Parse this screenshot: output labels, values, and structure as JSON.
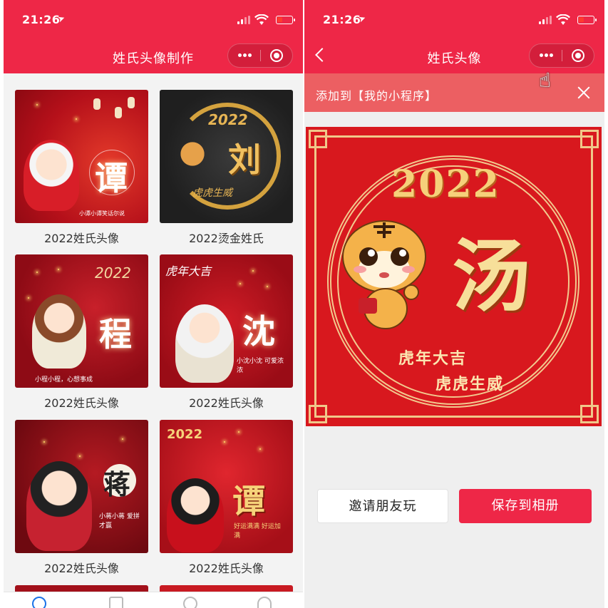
{
  "status": {
    "time": "21:26"
  },
  "left": {
    "title": "姓氏头像制作",
    "cards": [
      {
        "caption": "2022姓氏头像",
        "surname": "谭",
        "tagline": "小谭小谭笑话尔说"
      },
      {
        "caption": "2022烫金姓氏",
        "surname": "刘",
        "tagline": "虎虎生威",
        "year": "2022"
      },
      {
        "caption": "2022姓氏头像",
        "surname": "程",
        "tagline": "小程小程，心想事成",
        "year": "2022"
      },
      {
        "caption": "2022姓氏头像",
        "surname": "沈",
        "tagline": "小沈小沈 可爱浓浓",
        "badge": "虎年大吉"
      },
      {
        "caption": "2022姓氏头像",
        "surname": "蒋",
        "tagline": "小蒋小蒋 爱拼才赢"
      },
      {
        "caption": "2022姓氏头像",
        "surname": "谭",
        "tagline": "好运满满 好运加满",
        "year": "2022"
      }
    ]
  },
  "right": {
    "title": "姓氏头像",
    "add_bar_text": "添加到【我的小程序】",
    "poster": {
      "year": "2022",
      "surname": "汤",
      "blessing_1": "虎年大吉",
      "blessing_2": "虎虎生威"
    },
    "invite_label": "邀请朋友玩",
    "save_label": "保存到相册"
  },
  "colors": {
    "brand_red": "#ee2747",
    "add_bar": "#ec5f62",
    "gold": "#f6d07a"
  }
}
